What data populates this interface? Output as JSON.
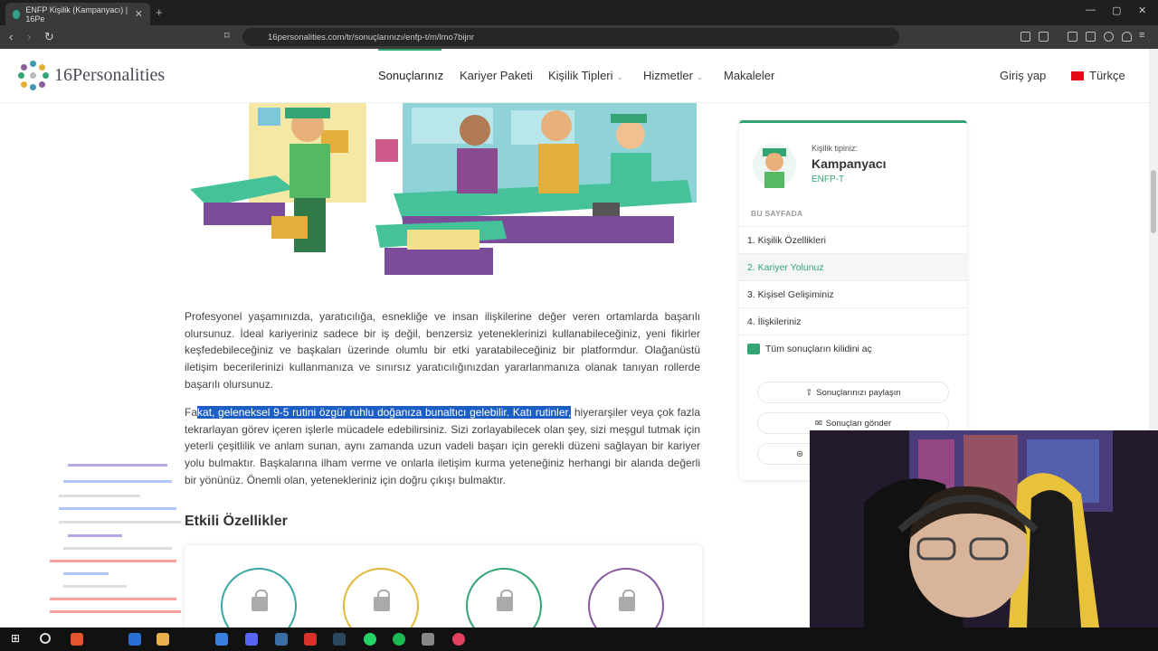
{
  "browser": {
    "tab_title": "ENFP Kişilik (Kampanyacı) | 16Pe",
    "url": "16personalities.com/tr/sonuçlarınızı/enfp-t/m/lmo7bijnr"
  },
  "site": {
    "logo_text": "16Personalities",
    "nav": [
      "Sonuçlarınız",
      "Kariyer Paketi",
      "Kişilik Tipleri",
      "Hizmetler",
      "Makaleler"
    ],
    "login": "Giriş yap",
    "language": "Türkçe"
  },
  "content": {
    "para1": "Profesyonel yaşamınızda, yaratıcılığa, esnekliğe ve insan ilişkilerine değer veren ortamlarda başarılı olursunuz. İdeal kariyeriniz sadece bir iş değil, benzersiz yeteneklerinizi kullanabileceğiniz, yeni fikirler keşfedebileceğiniz ve başkaları üzerinde olumlu bir etki yaratabileceğiniz bir platformdur. Olağanüstü iletişim becerilerinizi kullanmanıza ve sınırsız yaratıcılığınızdan yararlanmanıza olanak tanıyan rollerde başarılı olursunuz.",
    "para2_pre": "Fa",
    "para2_highlight": "kat, geleneksel 9-5 rutini özgür ruhlu doğanıza bunaltıcı gelebilir. Katı rutinler,",
    "para2_post": " hiyerarşiler veya çok fazla tekrarlayan görev içeren işlerle mücadele edebilirsiniz. Sizi zorlayabilecek olan şey, sizi meşgul tutmak için yeterli çeşitlilik ve anlam sunan, aynı zamanda uzun vadeli başarı için gerekli düzeni sağlayan bir kariyer yolu bulmaktır. Başkalarına ilham verme ve onlarla iletişim kurma yeteneğiniz herhangi bir alanda değerli bir yönünüz. Önemli olan, yetenekleriniz için doğru çıkışı bulmaktır.",
    "section_title": "Etkili Özellikler",
    "ring_colors": [
      "#3aa6a0",
      "#e2b93b",
      "#33a474",
      "#8a5a9f"
    ]
  },
  "sidebar": {
    "personality_label": "Kişilik tipiniz:",
    "personality_name": "Kampanyacı",
    "personality_code": "ENFP-T",
    "on_page": "BU SAYFADA",
    "items": [
      "1. Kişilik Özellikleri",
      "2. Kariyer Yolunuz",
      "3. Kişisel Gelişiminiz",
      "4. İlişkileriniz",
      "Tüm sonuçların kilidini aç"
    ],
    "share": "Sonuçlarınızı paylaşın",
    "send": "Sonuçları gönder"
  },
  "colors": {
    "accent": "#33a474",
    "highlight": "#1c5fc4"
  }
}
